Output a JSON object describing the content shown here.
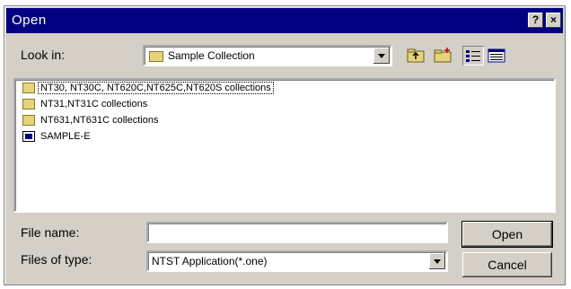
{
  "window": {
    "title": "Open",
    "help_button": "?",
    "close_button": "×"
  },
  "look_in": {
    "label": "Look in:",
    "value": "Sample Collection"
  },
  "toolbar": {
    "icons": [
      "up-one-level-icon",
      "create-new-folder-icon",
      "list-view-icon",
      "details-view-icon"
    ]
  },
  "file_list": {
    "items": [
      {
        "name": "NT30, NT30C, NT620C,NT625C,NT620S collections",
        "type": "folder"
      },
      {
        "name": "NT31,NT31C collections",
        "type": "folder"
      },
      {
        "name": "NT631,NT631C collections",
        "type": "folder"
      },
      {
        "name": "SAMPLE-E",
        "type": "file"
      }
    ]
  },
  "file_name": {
    "label": "File name:",
    "value": ""
  },
  "files_of_type": {
    "label": "Files of type:",
    "value": "NTST Application(*.one)"
  },
  "buttons": {
    "open": "Open",
    "cancel": "Cancel"
  },
  "colors": {
    "titlebar": "#000080",
    "face": "#d4d0c8",
    "folder": "#e8d37a"
  }
}
